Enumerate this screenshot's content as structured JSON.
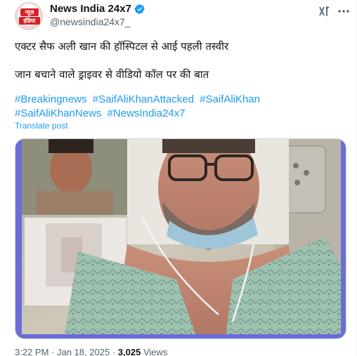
{
  "author": {
    "display_name": "News India 24x7",
    "handle": "@newsindia24x7_",
    "avatar_text_top": "न्यूज़",
    "avatar_text_bottom": "इंडिया"
  },
  "post": {
    "line1": "एक्टर सैफ अली खान की हॉस्पिटल से आई पहली तस्वीर",
    "line2": "जान बचाने वाले ड्राइवर से वीडियो कॉल पर की बात",
    "hashtags": [
      "#Breakingnews",
      "#SaifAliKhanAttacked",
      "#SaifAliKhan",
      "#SaifAliKhanNews",
      "#NewsIndia24x7"
    ],
    "translate_label": "Translate post"
  },
  "meta": {
    "time": "3:22 PM",
    "date": "Jan 18, 2025",
    "views_count": "3,025",
    "views_label": "Views"
  },
  "colors": {
    "accent": "#1d9bf0",
    "media_frame": "#6b6cd8",
    "text": "#0f1419",
    "muted": "#536471"
  },
  "icons": {
    "verified": "verified-badge-icon",
    "grok": "grok-icon",
    "more": "more-dots-icon"
  }
}
